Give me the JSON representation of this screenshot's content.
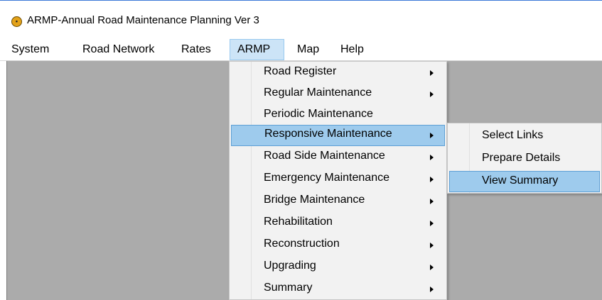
{
  "window": {
    "title": "ARMP-Annual Road Maintenance Planning Ver 3",
    "icon": "app-logo-icon"
  },
  "menubar": {
    "items": [
      {
        "label": "System"
      },
      {
        "label": "Road Network"
      },
      {
        "label": "Rates"
      },
      {
        "label": "ARMP",
        "active": true
      },
      {
        "label": "Map"
      },
      {
        "label": "Help"
      }
    ]
  },
  "armp_menu": {
    "items": [
      {
        "label": "Road Register",
        "has_submenu": true
      },
      {
        "label": "Regular Maintenance",
        "has_submenu": true
      },
      {
        "label": "Periodic Maintenance",
        "has_submenu": false
      },
      {
        "label": "Responsive Maintenance",
        "has_submenu": true,
        "highlighted": true
      },
      {
        "label": "Road Side Maintenance",
        "has_submenu": true
      },
      {
        "label": "Emergency Maintenance",
        "has_submenu": true
      },
      {
        "label": "Bridge Maintenance",
        "has_submenu": true
      },
      {
        "label": "Rehabilitation",
        "has_submenu": true
      },
      {
        "label": "Reconstruction",
        "has_submenu": true
      },
      {
        "label": "Upgrading",
        "has_submenu": true
      },
      {
        "label": "Summary",
        "has_submenu": true
      }
    ]
  },
  "responsive_submenu": {
    "items": [
      {
        "label": "Select Links"
      },
      {
        "label": "Prepare Details"
      },
      {
        "label": "View Summary",
        "highlighted": true
      }
    ]
  },
  "colors": {
    "menu_highlight": "#9ecbed",
    "menubar_active": "#cce4f7",
    "workspace": "#ababab",
    "menu_background": "#f2f2f2"
  }
}
